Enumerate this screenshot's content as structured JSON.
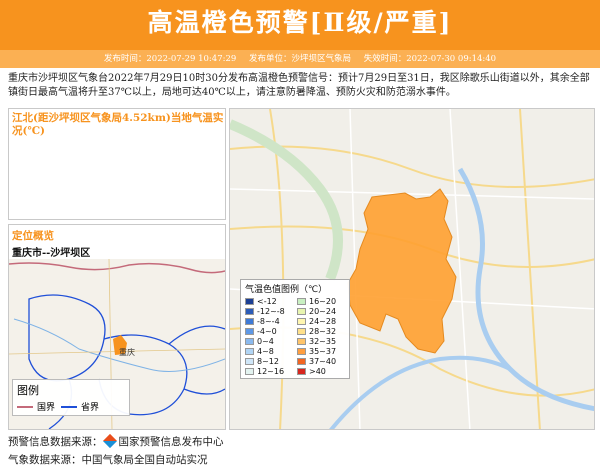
{
  "header": {
    "title": "高温橙色预警[Ⅱ级/严重]"
  },
  "meta": {
    "publish_time": "发布时间：2022-07-29 10:47:29",
    "issuer": "发布单位：沙坪坝区气象局",
    "expire_time": "失效时间：2022-07-30 09:14:40"
  },
  "description": "重庆市沙坪坝区气象台2022年7月29日10时30分发布高温橙色预警信号：预计7月29日至31日，我区除歌乐山街道以外，其余全部镇街日最高气温将升至37℃以上，局地可达40℃以上，请注意防暑降温、预防火灾和防范溺水事件。",
  "temp_panel": {
    "title": "江北(距沙坪坝区气象局4.52km)当地气温实况(℃)"
  },
  "location_panel": {
    "heading": "定位概览",
    "name": "重庆市--沙坪坝区"
  },
  "mini_map": {
    "legend_title": "图例",
    "legend_items": [
      {
        "label": "国界",
        "color": "#c46a7a"
      },
      {
        "label": "省界",
        "color": "#1f4fd8"
      }
    ],
    "city_label": "重庆"
  },
  "main_map": {
    "legend_title": "气温色值图例（℃）",
    "legend": [
      {
        "label": "<-12",
        "color": "#1c3f94"
      },
      {
        "label": "16~20",
        "color": "#c9f0c2"
      },
      {
        "label": "-12~-8",
        "color": "#2c5cb8"
      },
      {
        "label": "20~24",
        "color": "#e8f5b0"
      },
      {
        "label": "-8~-4",
        "color": "#3e7ad6"
      },
      {
        "label": "24~28",
        "color": "#fff6b0"
      },
      {
        "label": "-4~0",
        "color": "#5e98e6"
      },
      {
        "label": "28~32",
        "color": "#ffe08a"
      },
      {
        "label": "0~4",
        "color": "#8ab9ee"
      },
      {
        "label": "32~35",
        "color": "#ffc46a"
      },
      {
        "label": "4~8",
        "color": "#b0d4f4"
      },
      {
        "label": "35~37",
        "color": "#ff9e40"
      },
      {
        "label": "8~12",
        "color": "#cfe6f8"
      },
      {
        "label": "37~40",
        "color": "#f26522"
      },
      {
        "label": "12~16",
        "color": "#e3f3f0"
      },
      {
        "label": ">40",
        "color": "#d7261e"
      }
    ]
  },
  "footer": {
    "source1_label": "预警信息数据来源：",
    "source1_value": "国家预警信息发布中心",
    "source2": "气象数据来源：中国气象局全国自动站实况"
  },
  "colors": {
    "warning_orange": "#f7931e",
    "district_fill": "#ffa030"
  }
}
